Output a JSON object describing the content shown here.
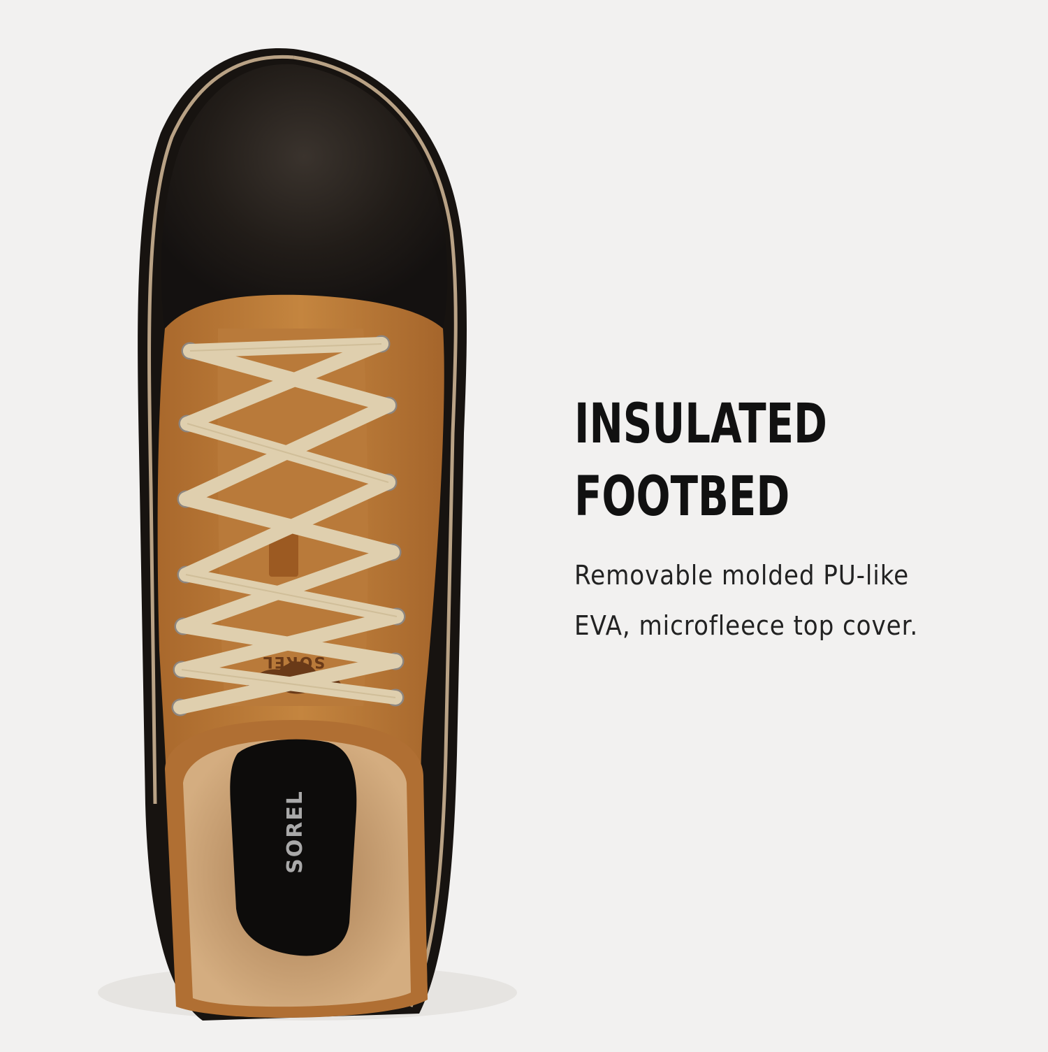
{
  "headline": {
    "line1": "INSULATED",
    "line2": "FOOTBED"
  },
  "description": {
    "line1": "Removable molded PU-like",
    "line2": "EVA, microfleece top cover."
  },
  "boot": {
    "tongue_brand": "SOREL",
    "insole_brand": "SOREL",
    "colors": {
      "background": "#f2f1f0",
      "suede": "#b87838",
      "rubber": "#1b1714",
      "welt_stripe": "#b9a285",
      "laces": "#dfcfae",
      "fleece": "#c49a6c",
      "insole": "#0d0c0b"
    }
  }
}
